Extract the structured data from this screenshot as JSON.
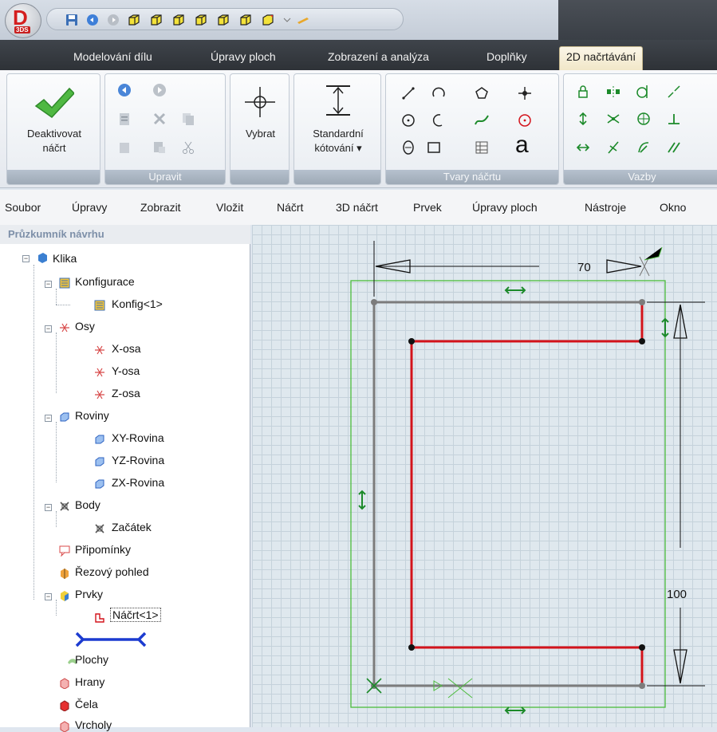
{
  "app": {
    "logo_text": "D",
    "logo_sub": "3DS"
  },
  "tabs": [
    {
      "label": "Modelování dílu"
    },
    {
      "label": "Úpravy ploch"
    },
    {
      "label": "Zobrazení a analýza"
    },
    {
      "label": "Doplňky"
    },
    {
      "label": "2D načrtávání",
      "active": true
    }
  ],
  "ribbon": {
    "deactivate_line1": "Deaktivovat",
    "deactivate_line2": "náčrt",
    "edit_group": "Upravit",
    "select": "Vybrat",
    "dimension_line1": "Standardní",
    "dimension_line2": "kótování",
    "shapes_group": "Tvary náčrtu",
    "constraints_group": "Vazby",
    "text_tool": "a"
  },
  "menubar": [
    "Soubor",
    "Úpravy",
    "Zobrazit",
    "Vložit",
    "Náčrt",
    "3D náčrt",
    "Prvek",
    "Úpravy ploch",
    "Nástroje",
    "Okno"
  ],
  "explorer": {
    "title": "Průzkumník návrhu",
    "root": "Klika",
    "config": "Konfigurace",
    "config_item": "Konfig<1>",
    "axes": "Osy",
    "x_axis": "X-osa",
    "y_axis": "Y-osa",
    "z_axis": "Z-osa",
    "planes": "Roviny",
    "xy_plane": "XY-Rovina",
    "yz_plane": "YZ-Rovina",
    "zx_plane": "ZX-Rovina",
    "points": "Body",
    "origin": "Začátek",
    "notes": "Připomínky",
    "section": "Řezový pohled",
    "features": "Prvky",
    "sketch": "Náčrt<1>",
    "surfaces": "Plochy",
    "edges": "Hrany",
    "faces": "Čela",
    "vertices": "Vrcholy"
  },
  "dimensions": {
    "width": "70",
    "height": "100"
  },
  "colors": {
    "accent_red": "#d3131b",
    "sketch_gray": "#7c7c7c",
    "constraint_green": "#1c8a2a",
    "bound_green": "#4cbc3c"
  }
}
